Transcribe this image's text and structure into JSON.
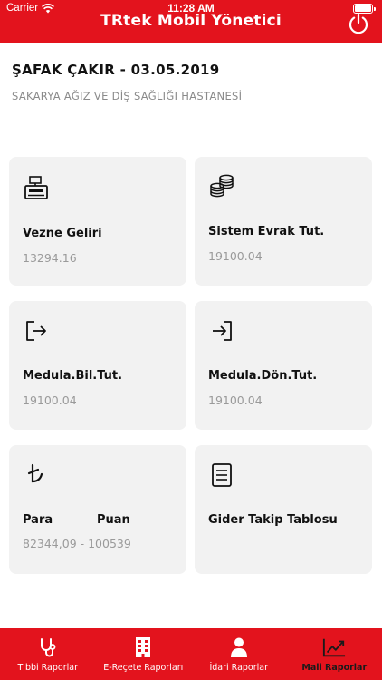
{
  "status": {
    "carrier": "Carrier",
    "time": "11:28 AM"
  },
  "app": {
    "title": "TRtek Mobil Yönetici"
  },
  "header": {
    "title": "ŞAFAK ÇAKIR - 03.05.2019",
    "subtitle": "SAKARYA AĞIZ VE DİŞ SAĞLIĞI HASTANESİ"
  },
  "cards": {
    "vezne": {
      "label": "Vezne Geliri",
      "value": "13294.16",
      "icon": "cash-register-icon"
    },
    "sistem": {
      "label": "Sistem Evrak Tut.",
      "value": "19100.04",
      "icon": "coins-icon"
    },
    "medula_bil": {
      "label": "Medula.Bil.Tut.",
      "value": "19100.04",
      "icon": "sign-out-icon"
    },
    "medula_don": {
      "label": "Medula.Dön.Tut.",
      "value": "19100.04",
      "icon": "sign-in-icon"
    },
    "para_puan": {
      "label_para": "Para",
      "label_puan": "Puan",
      "value": "82344,09 - 100539",
      "icon": "turkish-lira-icon"
    },
    "gider": {
      "label": "Gider Takip Tablosu",
      "icon": "document-list-icon"
    }
  },
  "tabs": [
    {
      "label": "Tıbbi Raporlar",
      "icon": "stethoscope-icon",
      "active": false
    },
    {
      "label": "E-Reçete Raporları",
      "icon": "building-icon",
      "active": false
    },
    {
      "label": "İdari Raporlar",
      "icon": "user-icon",
      "active": false
    },
    {
      "label": "Mali Raporlar",
      "icon": "chart-line-icon",
      "active": true
    }
  ],
  "colors": {
    "accent": "#e3131d",
    "card_bg": "#f2f2f2",
    "value_gray": "#9a9a9a"
  }
}
